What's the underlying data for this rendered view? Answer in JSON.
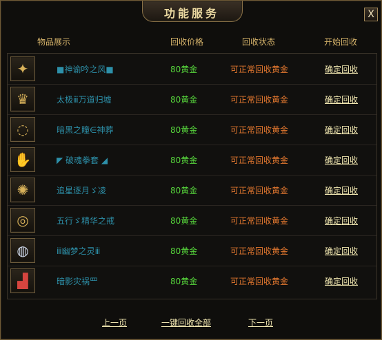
{
  "window": {
    "title": "功能服务",
    "close_label": "X"
  },
  "table": {
    "headers": [
      "物品展示",
      "回收价格",
      "回收状态",
      "开始回收"
    ],
    "rows": [
      {
        "name": "■神谕吟之风■",
        "price": "80黄金",
        "status": "可正常回收黄金",
        "action": "确定回收",
        "icon": "golden-armor-icon"
      },
      {
        "name": "太极ⅲ万道归墟",
        "price": "80黄金",
        "status": "可正常回收黄金",
        "action": "确定回收",
        "icon": "helmet-icon"
      },
      {
        "name": "暗黑之瞳∈神葬",
        "price": "80黄金",
        "status": "可正常回收黄金",
        "action": "确定回收",
        "icon": "necklace-icon"
      },
      {
        "name": "◤ 破魂拳套 ◢",
        "price": "80黄金",
        "status": "可正常回收黄金",
        "action": "确定回收",
        "icon": "glove-icon"
      },
      {
        "name": "追星逐月ゞ凌",
        "price": "80黄金",
        "status": "可正常回收黄金",
        "action": "确定回收",
        "icon": "bracelet-icon"
      },
      {
        "name": "五行ゞ精华之戒",
        "price": "80黄金",
        "status": "可正常回收黄金",
        "action": "确定回收",
        "icon": "ring-icon"
      },
      {
        "name": "ⅲ幽梦之灵ⅲ",
        "price": "80黄金",
        "status": "可正常回收黄金",
        "action": "确定回收",
        "icon": "silver-ring-icon"
      },
      {
        "name": "暗影灾祸罒",
        "price": "80黄金",
        "status": "可正常回收黄金",
        "action": "确定回收",
        "icon": "boots-icon"
      }
    ]
  },
  "footer": {
    "prev_label": "上一页",
    "all_label": "一键回收全部",
    "next_label": "下一页"
  }
}
